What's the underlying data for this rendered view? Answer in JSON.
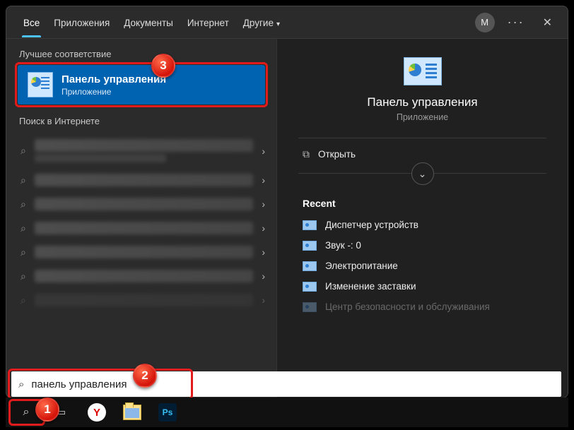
{
  "tabs": {
    "all": "Все",
    "apps": "Приложения",
    "docs": "Документы",
    "internet": "Интернет",
    "other": "Другие"
  },
  "avatar_initial": "М",
  "sections": {
    "best": "Лучшее соответствие",
    "net": "Поиск в Интернете"
  },
  "best_match": {
    "title": "Панель управления",
    "subtitle": "Приложение"
  },
  "preview": {
    "title": "Панель управления",
    "subtitle": "Приложение",
    "open": "Открыть",
    "recent_h": "Recent",
    "recent": [
      "Диспетчер устройств",
      "Звук -: 0",
      "Электропитание",
      "Изменение заставки",
      "Центр безопасности и обслуживания"
    ]
  },
  "search": {
    "value": "панель управления",
    "placeholder": ""
  },
  "taskbar": {
    "ps": "Ps",
    "y": "Y"
  },
  "callouts": {
    "c1": "1",
    "c2": "2",
    "c3": "3"
  }
}
